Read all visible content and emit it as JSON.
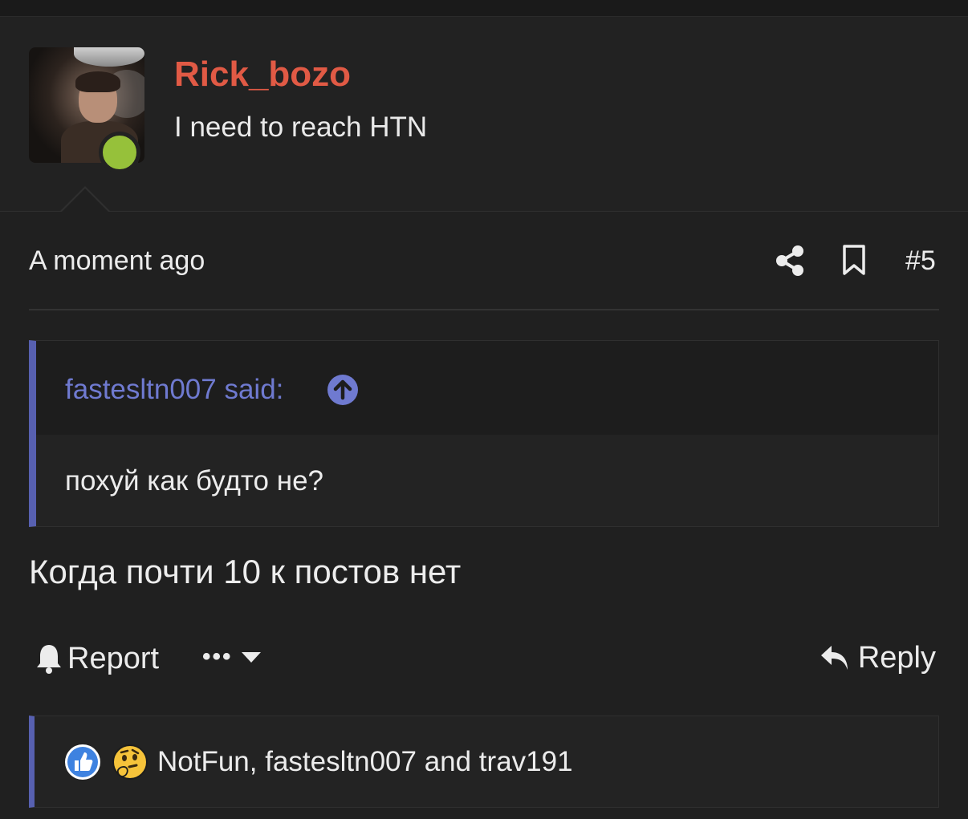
{
  "post_author": {
    "username": "Rick_bozo",
    "user_title": "I need to reach HTN",
    "online_status": "online",
    "username_color": "#e15a45",
    "online_color": "#96c13a"
  },
  "meta": {
    "timestamp": "A moment ago",
    "post_number": "#5",
    "share_icon": "share-icon",
    "bookmark_icon": "bookmark-icon"
  },
  "quote": {
    "author_said": "fastesltn007 said:",
    "jump_icon": "arrow-up-circle-icon",
    "text": "похуй как будто не?",
    "accent_color": "#5760b0"
  },
  "post": {
    "body": "Когда почти 10 к постов нет"
  },
  "actions": {
    "report_label": "Report",
    "more_label": "•••",
    "reply_label": "Reply"
  },
  "reactions": {
    "icons": [
      "thumbs-up-icon",
      "thinking-face-icon"
    ],
    "text": "NotFun, fastesltn007 and trav191"
  }
}
